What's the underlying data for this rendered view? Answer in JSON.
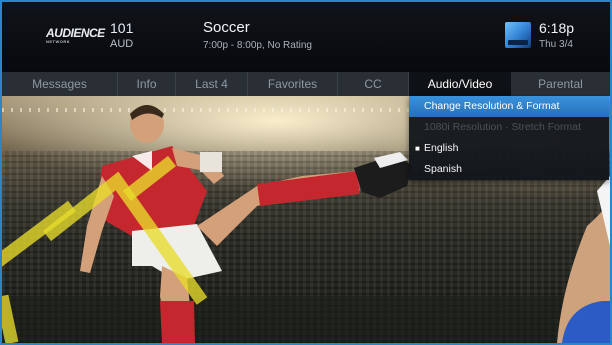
{
  "header": {
    "network_logo": "AUDIENCE",
    "network_logo_sub": "NETWORK",
    "channel_number": "101",
    "channel_callsign": "AUD",
    "program_title": "Soccer",
    "program_details": "7:00p - 8:00p, No Rating",
    "provider_logo_icon": "directv-logo-icon",
    "time": "6:18p",
    "date": "Thu 3/4"
  },
  "tabs": [
    {
      "label": "Messages",
      "active": false
    },
    {
      "label": "Info",
      "active": false
    },
    {
      "label": "Last 4",
      "active": false
    },
    {
      "label": "Favorites",
      "active": false
    },
    {
      "label": "CC",
      "active": false
    },
    {
      "label": "Audio/Video",
      "active": true
    },
    {
      "label": "Parental",
      "active": false
    }
  ],
  "audio_video_menu": {
    "items": [
      {
        "label": "Change Resolution & Format",
        "state": "selected"
      },
      {
        "label": "1080i Resolution · Stretch Format",
        "state": "disabled"
      },
      {
        "label": "English",
        "state": "checked"
      },
      {
        "label": "Spanish",
        "state": "normal"
      }
    ]
  },
  "colors": {
    "accent_blue": "#2b86c9",
    "selection_blue": "#2f7fd0",
    "highlight_yellow": "#e8dc2a"
  }
}
